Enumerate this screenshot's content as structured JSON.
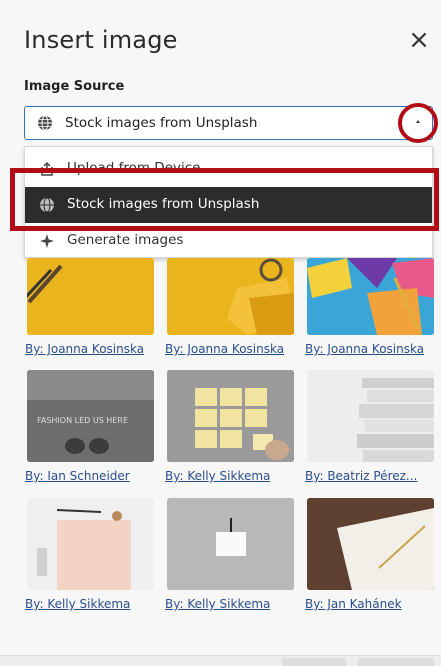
{
  "dialog": {
    "title": "Insert image",
    "close_glyph": "×"
  },
  "source": {
    "label": "Image Source",
    "selected": "Stock images from Unsplash",
    "options": [
      "Upload from Device",
      "Stock images from Unsplash",
      "Generate images"
    ]
  },
  "icons": {
    "globe": "globe-icon",
    "upload": "upload-icon",
    "sparkle": "sparkle-icon",
    "caret": "caret-up-icon",
    "close": "close-icon"
  },
  "colors": {
    "accent": "#3b6fb6",
    "highlight": "#b10d17",
    "menu_selected_bg": "#2c2c2c",
    "link": "#2b4e8c"
  },
  "images": [
    {
      "credit": "By: Joanna Kosinska"
    },
    {
      "credit": "By: Joanna Kosinska"
    },
    {
      "credit": "By: Joanna Kosinska"
    },
    {
      "credit": "By: Ian Schneider",
      "thumb_text": "FASHION LED US HERE"
    },
    {
      "credit": "By: Kelly Sikkema"
    },
    {
      "credit": "By: Beatriz Pérez..."
    },
    {
      "credit": "By: Kelly Sikkema"
    },
    {
      "credit": "By: Kelly Sikkema"
    },
    {
      "credit": "By: Jan Kahánek"
    }
  ]
}
